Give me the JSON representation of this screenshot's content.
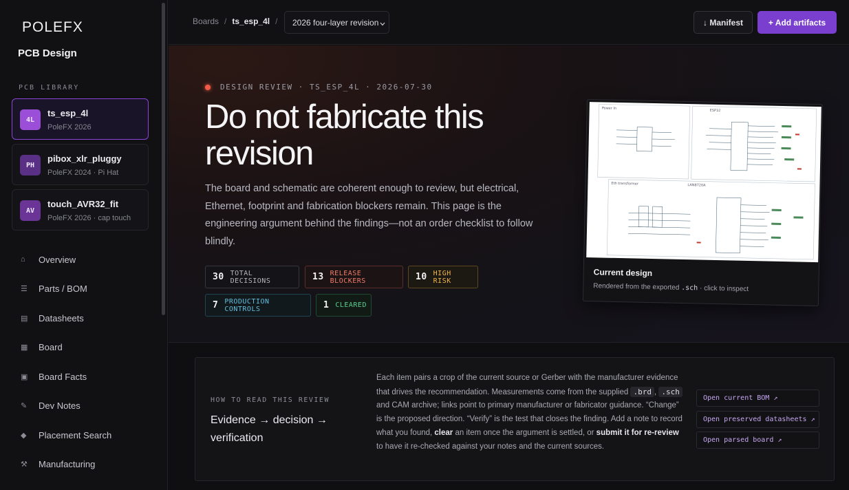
{
  "sidebar": {
    "logo": "POLEFX",
    "app_title": "PCB Design",
    "library_heading": "PCB LIBRARY",
    "boards": [
      {
        "badge": "4L",
        "name": "ts_esp_4l",
        "sub": "PoleFX 2026",
        "color": "#9b4fd9"
      },
      {
        "badge": "PH",
        "name": "pibox_xlr_pluggy",
        "sub": "PoleFX 2024 · Pi Hat",
        "color": "#5a2f86"
      },
      {
        "badge": "AV",
        "name": "touch_AVR32_fit",
        "sub": "PoleFX 2026 · cap touch",
        "color": "#6a3596"
      }
    ],
    "nav": [
      {
        "icon": "⌂",
        "label": "Overview"
      },
      {
        "icon": "☰",
        "label": "Parts / BOM"
      },
      {
        "icon": "▤",
        "label": "Datasheets"
      },
      {
        "icon": "▦",
        "label": "Board"
      },
      {
        "icon": "▣",
        "label": "Board Facts"
      },
      {
        "icon": "✎",
        "label": "Dev Notes"
      },
      {
        "icon": "◆",
        "label": "Placement Search"
      },
      {
        "icon": "⚒",
        "label": "Manufacturing"
      }
    ]
  },
  "topbar": {
    "breadcrumb_root": "Boards",
    "breadcrumb_sep": "/",
    "breadcrumb_board": "ts_esp_4l",
    "revision": "2026 four-layer revision",
    "manifest_label": "↓ Manifest",
    "add_label": "+ Add artifacts"
  },
  "hero": {
    "tag": "DESIGN REVIEW · TS_ESP_4L · 2026-07-30",
    "title": "Do not fabricate this revision",
    "description": "The board and schematic are coherent enough to review, but electrical, Ethernet, footprint and fabrication blockers remain. This page is the engineering argument behind the findings—not an order checklist to follow blindly.",
    "stats": [
      {
        "value": "30",
        "label": "TOTAL DECISIONS"
      },
      {
        "value": "13",
        "label": "RELEASE BLOCKERS"
      },
      {
        "value": "10",
        "label": "HIGH RISK"
      },
      {
        "value": "7",
        "label": "PRODUCTION CONTROLS"
      },
      {
        "value": "1",
        "label": "CLEARED"
      }
    ],
    "preview": {
      "section_power": "Power In",
      "section_mcu": "ESP32",
      "section_eth": "Eth transformer",
      "section_phy": "LAN8720A",
      "title": "Current design",
      "sub_prefix": "Rendered from the exported",
      "sub_ext": ".sch",
      "sub_suffix": "· click to inspect"
    }
  },
  "howto": {
    "kicker": "HOW TO READ THIS REVIEW",
    "heading": "Evidence → decision → verification",
    "body": {
      "p1": "Each item pairs a crop of the current source or Gerber with the manufacturer evidence that drives the recommendation. Measurements come from the supplied",
      "code1": ".brd",
      "comma": ",",
      "code2": ".sch",
      "p2": "and CAM archive; links point to primary manufacturer or fabricator guidance. “Change” is the proposed direction. “Verify” is the test that closes the finding. Add a note to record what you found,",
      "b1": "clear",
      "p3": "an item once the argument is settled, or",
      "b2": "submit it for re-review",
      "p4": "to have it re-checked against your notes and the current sources."
    },
    "links": [
      "Open current BOM ↗",
      "Open preserved datasheets ↗",
      "Open parsed board ↗"
    ]
  }
}
